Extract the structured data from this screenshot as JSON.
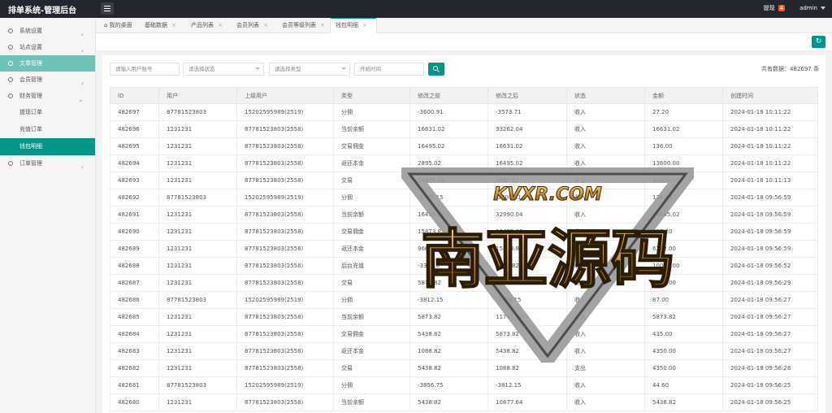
{
  "app": {
    "title": "排单系统-管理后台"
  },
  "topbar": {
    "withdraw_label": "提现",
    "withdraw_count": "4",
    "user": "admin"
  },
  "sidebar": {
    "items": [
      {
        "label": "系统设置",
        "icon": "gear-icon"
      },
      {
        "label": "站点设置",
        "icon": "site-icon"
      },
      {
        "label": "文章管理",
        "icon": "article-icon"
      },
      {
        "label": "会员管理",
        "icon": "user-icon"
      },
      {
        "label": "财务管理",
        "icon": "finance-icon"
      }
    ],
    "sub_items": [
      {
        "label": "提现订单"
      },
      {
        "label": "充值订单"
      },
      {
        "label": "钱包明细"
      }
    ],
    "last_item": {
      "label": "订单管理",
      "icon": "order-icon"
    }
  },
  "tabs": [
    {
      "label": "我的桌面"
    },
    {
      "label": "基础数据"
    },
    {
      "label": "产品列表"
    },
    {
      "label": "会员列表"
    },
    {
      "label": "会员等级列表"
    },
    {
      "label": "钱包明细"
    }
  ],
  "filters": {
    "phone_placeholder": "请输入用户账号",
    "status_placeholder": "请选择状态",
    "type_placeholder": "请选择类型",
    "time_placeholder": "开始时间"
  },
  "total": {
    "label": "共有数据：",
    "value": "482697",
    "unit": "条"
  },
  "table": {
    "columns": [
      "ID",
      "用户",
      "上级用户",
      "类型",
      "修改之前",
      "修改之后",
      "状态",
      "金额",
      "创建时间"
    ],
    "rows": [
      [
        "482697",
        "87781523803",
        "15202595989(2519)",
        "分佣",
        "-3600.91",
        "-3573.71",
        "收入",
        "27.20",
        "2024-01-18 10:11:22"
      ],
      [
        "482696",
        "1231231",
        "87781523803(2558)",
        "当前余额",
        "16631.02",
        "33262.04",
        "收入",
        "16631.02",
        "2024-01-18 10:11:22"
      ],
      [
        "482695",
        "1231231",
        "87781523803(2558)",
        "交易佣金",
        "16495.02",
        "16631.02",
        "收入",
        "136.00",
        "2024-01-18 10:11:22"
      ],
      [
        "482694",
        "1231231",
        "87781523803(2558)",
        "返还本金",
        "2895.02",
        "16495.02",
        "收入",
        "13600.00",
        "2024-01-18 10:11:22"
      ],
      [
        "482693",
        "1231231",
        "87781523803(2558)",
        "交易",
        "16495.02",
        "2895.02",
        "支出",
        "13600.00",
        "2024-01-18 10:11:13"
      ],
      [
        "482692",
        "87781523803",
        "15202595989(2519)",
        "分佣",
        "-3725.15",
        "-3600.91",
        "收入",
        "124.24",
        "2024-01-18 09:56:59"
      ],
      [
        "482691",
        "1231231",
        "87781523803(2558)",
        "当前余额",
        "16495.02",
        "32990.04",
        "收入",
        "16495.02",
        "2024-01-18 09:56:59"
      ],
      [
        "482690",
        "1231231",
        "87781523803(2558)",
        "交易佣金",
        "15873.82",
        "16495.02",
        "收入",
        "621.20",
        "2024-01-18 09:56:59"
      ],
      [
        "482689",
        "1231231",
        "87781523803(2558)",
        "返还本金",
        "9661.82",
        "15873.82",
        "收入",
        "6212.00",
        "2024-01-18 09:56:59"
      ],
      [
        "482688",
        "1231231",
        "87781523803(2558)",
        "后台充值",
        "-338.18",
        "9661.82",
        "收入",
        "10000.00",
        "2024-01-18 09:56:52"
      ],
      [
        "482687",
        "1231231",
        "87781523803(2558)",
        "交易",
        "5873.82",
        "-338.18",
        "支出",
        "6212.00",
        "2024-01-18 09:56:29"
      ],
      [
        "482686",
        "87781523803",
        "15202595989(2519)",
        "分佣",
        "-3812.15",
        "-3725.15",
        "收入",
        "87.00",
        "2024-01-18 09:56:27"
      ],
      [
        "482685",
        "1231231",
        "87781523803(2558)",
        "当前余额",
        "5873.82",
        "11747.64",
        "收入",
        "5873.82",
        "2024-01-18 09:56:27"
      ],
      [
        "482684",
        "1231231",
        "87781523803(2558)",
        "交易佣金",
        "5438.82",
        "5873.82",
        "收入",
        "435.00",
        "2024-01-18 09:56:27"
      ],
      [
        "482683",
        "1231231",
        "87781523803(2558)",
        "返还本金",
        "1088.82",
        "5438.82",
        "收入",
        "4350.00",
        "2024-01-18 09:56:27"
      ],
      [
        "482682",
        "1231231",
        "87781523803(2558)",
        "交易",
        "5438.82",
        "1088.82",
        "支出",
        "4350.00",
        "2024-01-18 09:56:26"
      ],
      [
        "482681",
        "87781523803",
        "15202595989(2519)",
        "分佣",
        "-3856.75",
        "-3812.15",
        "收入",
        "44.60",
        "2024-01-18 09:56:25"
      ],
      [
        "482680",
        "1231231",
        "87781523803(2558)",
        "当前余额",
        "5438.82",
        "10877.64",
        "收入",
        "5438.82",
        "2024-01-18 09:56:25"
      ]
    ]
  },
  "watermark": {
    "domain": "KVXR.COM",
    "text": "南亚源码"
  },
  "colors": {
    "accent": "#009688",
    "topbar": "#23262e",
    "badge": "#ff5722"
  }
}
